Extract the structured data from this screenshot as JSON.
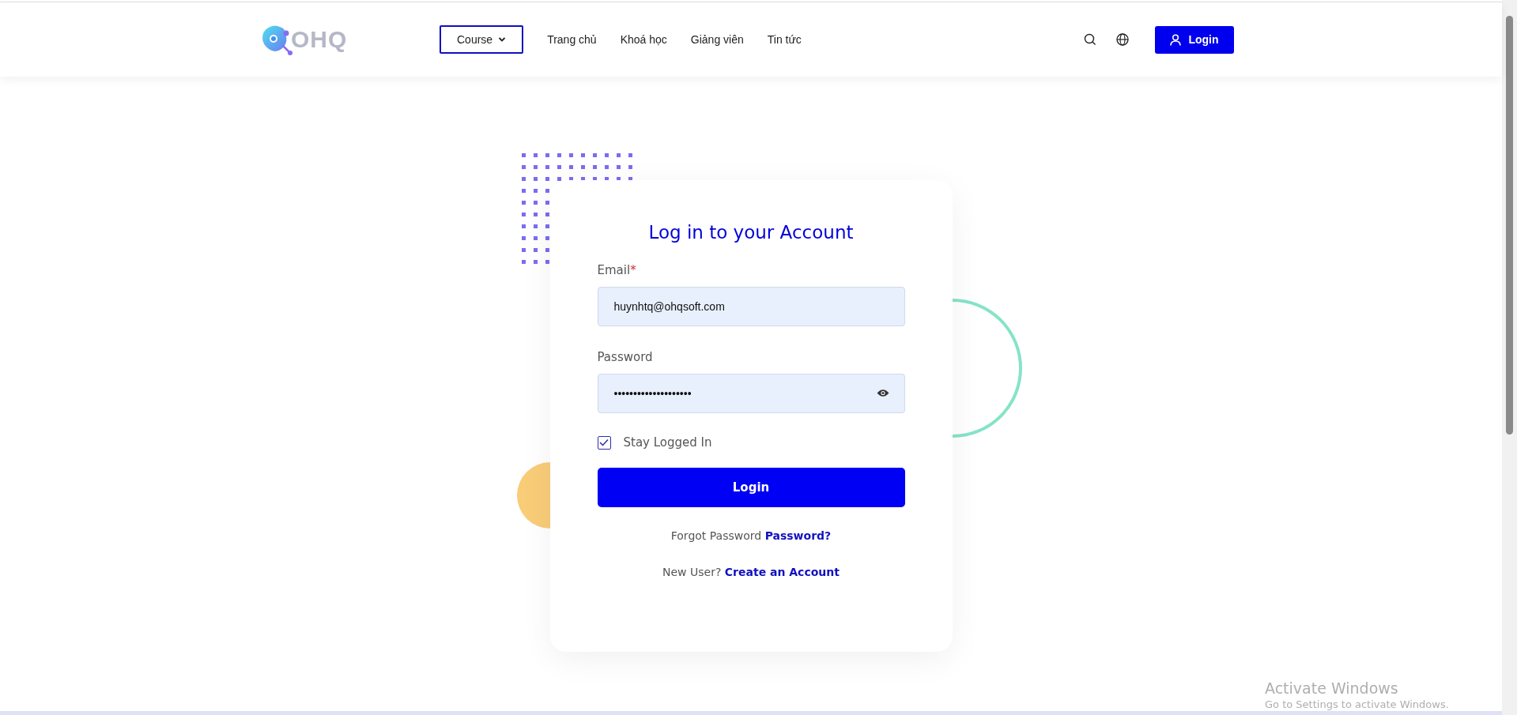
{
  "header": {
    "logo": "OHQ",
    "nav": [
      {
        "label": "Course",
        "kind": "dropdown"
      },
      {
        "label": "Trang chủ",
        "kind": "link"
      },
      {
        "label": "Khoá học",
        "kind": "link"
      },
      {
        "label": "Giảng viên",
        "kind": "link"
      },
      {
        "label": "Tin tức",
        "kind": "link"
      }
    ],
    "login_button": "Login"
  },
  "login_card": {
    "title": "Log in to your Account",
    "email": {
      "label": "Email",
      "required_mark": "*",
      "value": "huynhtq@ohqsoft.com"
    },
    "password": {
      "label": "Password",
      "value": "••••••••••••••••••••"
    },
    "remember": {
      "label": "Stay Logged In",
      "checked": true
    },
    "submit": "Login",
    "forgot": {
      "text": "Forgot Password",
      "link": "Password?"
    },
    "signup": {
      "text": "New User?",
      "link": "Create an Account"
    }
  },
  "os_overlay": {
    "title": "Activate Windows",
    "subtitle": "Go to Settings to activate Windows."
  }
}
